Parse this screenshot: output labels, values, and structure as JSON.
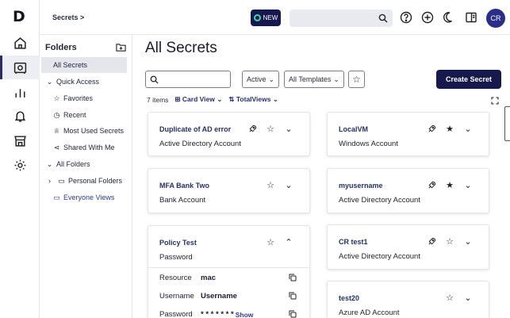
{
  "app": {
    "logo": "D",
    "breadcrumb": "Secrets >",
    "new_label": "NEW",
    "avatar_initials": "CR"
  },
  "rail": [
    {
      "name": "home-icon"
    },
    {
      "name": "vault-icon",
      "active": true
    },
    {
      "name": "reports-icon"
    },
    {
      "name": "bell-icon"
    },
    {
      "name": "store-icon"
    },
    {
      "name": "gear-icon"
    }
  ],
  "folders": {
    "title": "Folders",
    "items": [
      {
        "label": "All Secrets",
        "selected": true
      },
      {
        "label": "Quick Access",
        "chevron": "⌄"
      },
      {
        "label": "Favorites",
        "icon": "☆"
      },
      {
        "label": "Recent",
        "icon": "◷"
      },
      {
        "label": "Most Used Secrets",
        "icon": "♕"
      },
      {
        "label": "Shared With Me",
        "icon": "⋖"
      },
      {
        "label": "All Folders",
        "chevron": "⌄"
      },
      {
        "label": "Personal Folders",
        "icon": "▭",
        "chevron": "›"
      },
      {
        "label": "Everyone Views",
        "icon": "▭",
        "link": true
      }
    ]
  },
  "main": {
    "title": "All Secrets",
    "search_placeholder": "",
    "filters": {
      "status": "Active",
      "templates": "All Templates"
    },
    "create_label": "Create Secret",
    "item_count": "7 items",
    "view_mode": "Card View",
    "sort": "TotalViews"
  },
  "cards": [
    {
      "name": "Duplicate of AD error",
      "type": "Active Directory Account",
      "pinned": true,
      "favorite": false,
      "expanded": false
    },
    {
      "name": "LocalVM",
      "type": "Windows Account",
      "pinned": true,
      "favorite": true,
      "expanded": false
    },
    {
      "name": "MFA Bank Two",
      "type": "Bank Account",
      "pinned": false,
      "favorite": false,
      "expanded": false
    },
    {
      "name": "myusername",
      "type": "Active Directory Account",
      "pinned": true,
      "favorite": true,
      "expanded": false
    },
    {
      "name": "Policy Test",
      "type": "Password",
      "pinned": false,
      "favorite": false,
      "expanded": true,
      "details": [
        {
          "label": "Resource",
          "value": "mac"
        },
        {
          "label": "Username",
          "value": "Username"
        },
        {
          "label": "Password",
          "value": "* * * * * * *",
          "action": "Show"
        }
      ]
    },
    {
      "name": "CR test1",
      "type": "Active Directory Account",
      "pinned": true,
      "favorite": false,
      "expanded": false
    },
    {
      "name": "test20",
      "type": "Azure AD Account",
      "pinned": false,
      "favorite": false,
      "expanded": false
    }
  ],
  "colors": {
    "brand_dark": "#17194d",
    "link": "#24306b",
    "new_accent": "#42d9a8",
    "avatar": "#2b2e88"
  }
}
